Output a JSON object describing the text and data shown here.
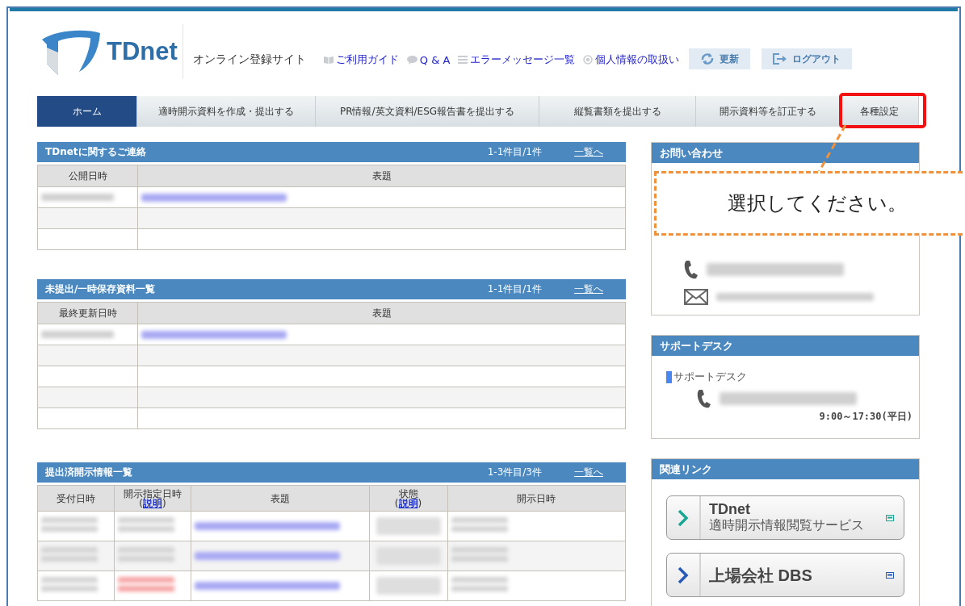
{
  "header": {
    "logo_text": "TDnet",
    "site_title": "オンライン登録サイト",
    "links": [
      {
        "label": "ご利用ガイド",
        "kind": "guide"
      },
      {
        "label": "Q & A",
        "kind": "faq"
      },
      {
        "label": "エラーメッセージ一覧",
        "kind": "list"
      },
      {
        "label": "個人情報の取扱い",
        "kind": "privacy"
      }
    ],
    "buttons": [
      {
        "label": "更新",
        "kind": "refresh"
      },
      {
        "label": "ログアウト",
        "kind": "logout"
      }
    ]
  },
  "nav": [
    {
      "label": "ホーム",
      "selected": true,
      "annotated": false
    },
    {
      "label": "適時開示資料を作成・提出する",
      "selected": false,
      "annotated": false
    },
    {
      "label": "PR情報/英文資料/ESG報告書を提出する",
      "selected": false,
      "annotated": false
    },
    {
      "label": "縦覧書類を提出する",
      "selected": false,
      "annotated": false
    },
    {
      "label": "開示資料等を訂正する",
      "selected": false,
      "annotated": false
    },
    {
      "label": "各種設定",
      "selected": false,
      "annotated": true
    }
  ],
  "panels": [
    {
      "title": "TDnetに関するご連絡",
      "range": "1-1件目/1件",
      "more_link": "一覧へ",
      "columns": [
        {
          "label": "公開日時",
          "kind": "date"
        },
        {
          "label": "表題",
          "kind": "link"
        }
      ],
      "rows": [
        {
          "redacted": true
        },
        {
          "redacted": false
        },
        {
          "redacted": false
        }
      ]
    },
    {
      "title": "未提出/一時保存資料一覧",
      "range": "1-1件目/1件",
      "more_link": "一覧へ",
      "columns": [
        {
          "label": "最終更新日時",
          "kind": "date"
        },
        {
          "label": "表題",
          "kind": "link"
        }
      ],
      "rows": [
        {
          "redacted": true
        },
        {
          "redacted": false
        },
        {
          "redacted": false
        },
        {
          "redacted": false
        },
        {
          "redacted": false
        }
      ]
    },
    {
      "title": "提出済開示情報一覧",
      "range": "1-3件目/3件",
      "more_link": "一覧へ",
      "columns": [
        {
          "label": "受付日時",
          "kind": "date"
        },
        {
          "label": "開示指定日時",
          "kind": "scheduled",
          "help": {
            "open": "(",
            "link": "説明",
            "close": ")"
          }
        },
        {
          "label": "表題",
          "kind": "link"
        },
        {
          "label": "状態",
          "kind": "status",
          "help": {
            "open": "(",
            "link": "説明",
            "close": ")"
          }
        },
        {
          "label": "開示日時",
          "kind": "date"
        }
      ],
      "rows": [
        {
          "redacted": true,
          "overdue": false
        },
        {
          "redacted": true,
          "overdue": false
        },
        {
          "redacted": true,
          "overdue": true
        }
      ]
    }
  ],
  "contact": {
    "title": "お問い合わせ"
  },
  "support": {
    "title": "サポートデスク",
    "label": "サポートデスク",
    "hours": "9:00～17:30(平日)"
  },
  "related": {
    "title": "関連リンク",
    "items": [
      {
        "title": "TDnet",
        "subtitle": "適時開示情報閲覧サービス",
        "color": "#19a894"
      },
      {
        "title": "上場会社 DBS",
        "color": "#2659b8"
      }
    ]
  },
  "callout": {
    "text": "選択してください。"
  }
}
